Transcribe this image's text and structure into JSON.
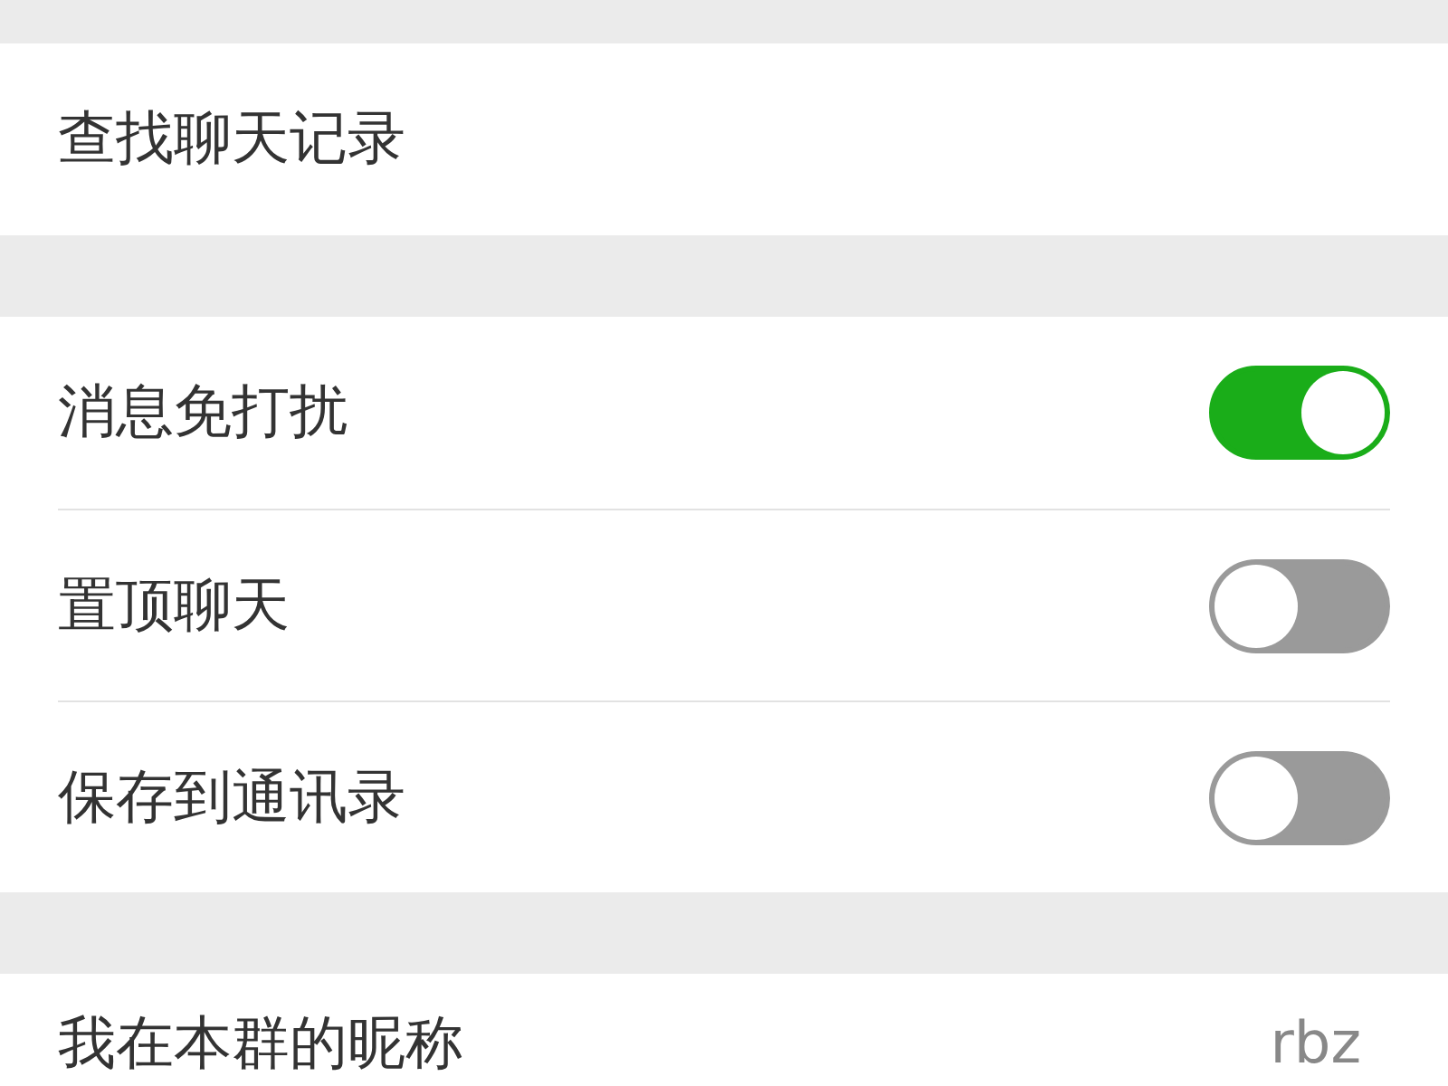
{
  "sections": [
    {
      "rows": [
        {
          "kind": "link",
          "label": "查找聊天记录"
        }
      ]
    },
    {
      "rows": [
        {
          "kind": "switch",
          "label": "消息免打扰",
          "on": true
        },
        {
          "kind": "switch",
          "label": "置顶聊天",
          "on": false
        },
        {
          "kind": "switch",
          "label": "保存到通讯录",
          "on": false
        }
      ]
    },
    {
      "rows": [
        {
          "kind": "value",
          "label": "我在本群的昵称",
          "value": "rbz"
        }
      ]
    }
  ]
}
